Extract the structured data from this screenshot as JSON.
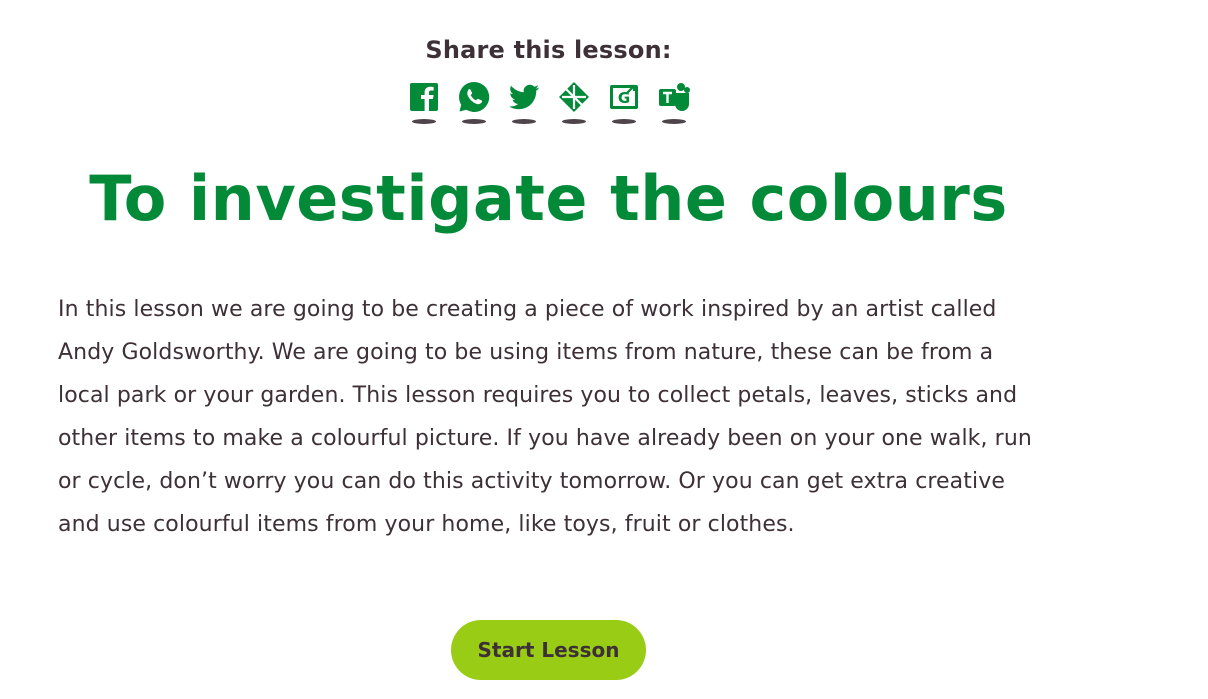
{
  "share": {
    "title": "Share this lesson:",
    "icons": [
      {
        "name": "facebook-icon"
      },
      {
        "name": "whatsapp-icon"
      },
      {
        "name": "twitter-icon"
      },
      {
        "name": "google-classroom-icon"
      },
      {
        "name": "google-classroom-share-icon"
      },
      {
        "name": "microsoft-teams-icon"
      }
    ]
  },
  "lesson": {
    "title": "To investigate the colours",
    "description": "In this lesson we are going to be creating a piece of work inspired by an artist called Andy Goldsworthy. We are going to be using items from nature, these can be from a local park or your garden. This lesson requires you to collect petals, leaves, sticks and other items to make a colourful picture. If you have already been on your one walk, run or cycle, don’t worry you can do this activity tomorrow. Or you can get extra creative and use colourful items from your home, like toys, fruit or clothes.",
    "start_label": "Start Lesson"
  },
  "colors": {
    "brand_green": "#028a38",
    "button_green": "#99cc14",
    "text": "#3d3037"
  }
}
